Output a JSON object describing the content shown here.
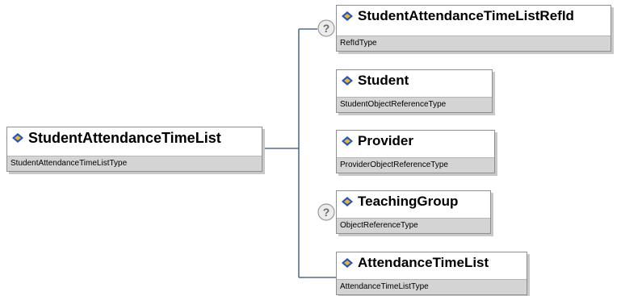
{
  "root": {
    "name": "StudentAttendanceTimeList",
    "type": "StudentAttendanceTimeListType"
  },
  "children": [
    {
      "name": "StudentAttendanceTimeListRefId",
      "type": "RefIdType",
      "optional": true
    },
    {
      "name": "Student",
      "type": "StudentObjectReferenceType",
      "optional": false
    },
    {
      "name": "Provider",
      "type": "ProviderObjectReferenceType",
      "optional": false
    },
    {
      "name": "TeachingGroup",
      "type": "ObjectReferenceType",
      "optional": true
    },
    {
      "name": "AttendanceTimeList",
      "type": "AttendanceTimeListType",
      "optional": false
    }
  ],
  "optional_marker": "?",
  "icons": {
    "element": "diamond-element-icon",
    "optional": "question-circle-icon"
  },
  "colors": {
    "line": "#2d4f7c",
    "type_band": "#d4d4d4",
    "icon_blue": "#1f55c6",
    "icon_gold": "#f0b428"
  }
}
